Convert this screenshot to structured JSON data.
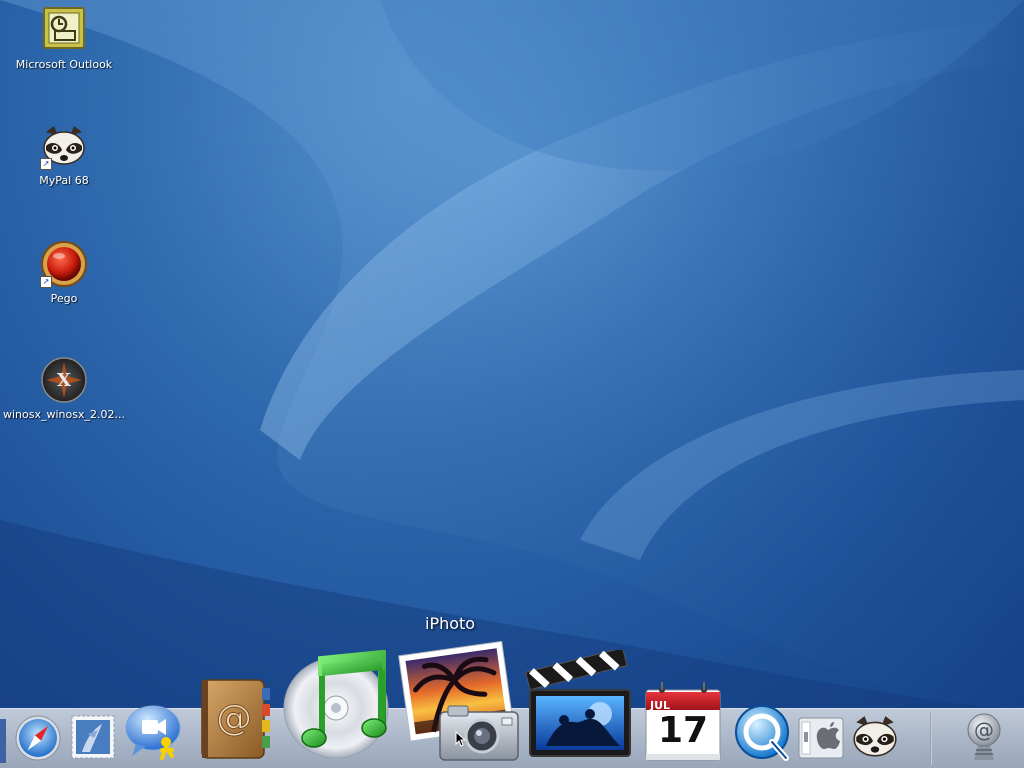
{
  "desktop": {
    "icons": [
      {
        "label": "Microsoft Outlook",
        "icon": "outlook-icon"
      },
      {
        "label": "MyPal 68",
        "icon": "raccoon-icon"
      },
      {
        "label": "Pego",
        "icon": "red-orb-icon"
      },
      {
        "label": "winosx_winosx_2.02...",
        "icon": "x-orb-icon"
      }
    ]
  },
  "dock": {
    "tooltip": "iPhoto",
    "items": [
      {
        "name": "safari",
        "icon": "safari-compass-icon"
      },
      {
        "name": "mail",
        "icon": "mail-stamp-icon"
      },
      {
        "name": "ichat",
        "icon": "ichat-icon"
      },
      {
        "name": "address-book",
        "icon": "address-book-icon"
      },
      {
        "name": "itunes",
        "icon": "itunes-icon"
      },
      {
        "name": "iphoto",
        "icon": "iphoto-icon"
      },
      {
        "name": "imovie",
        "icon": "imovie-icon"
      },
      {
        "name": "ical",
        "icon": "ical-icon",
        "month": "JUL",
        "day": "17"
      },
      {
        "name": "quicktime",
        "icon": "quicktime-icon"
      },
      {
        "name": "system-preferences",
        "icon": "system-preferences-icon"
      },
      {
        "name": "mypal",
        "icon": "raccoon-icon"
      },
      {
        "name": "mail-drop",
        "icon": "at-sign-icon"
      }
    ]
  },
  "colors": {
    "background": "#1d4f97",
    "dock_shelf": "#b3bdcb",
    "calendar_red": "#d2202a"
  }
}
